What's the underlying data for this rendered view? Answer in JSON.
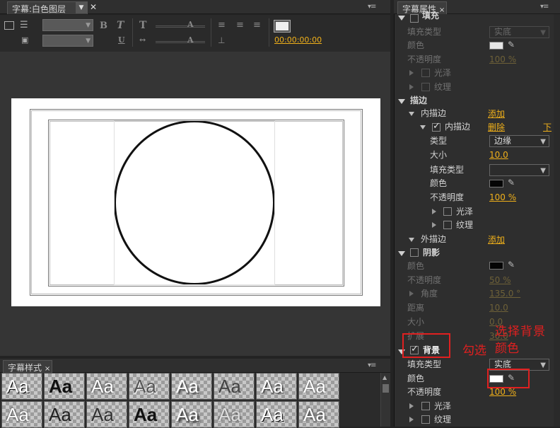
{
  "left_panel": {
    "tab_label": "字幕:白色图层",
    "timecode": "00:00:00:00"
  },
  "style_panel": {
    "tab_label": "字幕样式",
    "sample_text": "Aa"
  },
  "props": {
    "tab_label": "字幕属性",
    "fill_header": "填充",
    "fill_type_label": "填充类型",
    "fill_type_value": "实底",
    "fill_color_label": "颜色",
    "fill_opacity_label": "不透明度",
    "fill_opacity_value": "100 %",
    "fill_sheen": "光泽",
    "fill_texture": "纹理",
    "stroke_header": "描边",
    "inner_stroke": "内描边",
    "add_link": "添加",
    "inner_stroke_item": "内描边",
    "delete_link": "删除",
    "down_link": "下",
    "type_label": "类型",
    "type_value": "边缘",
    "size_label": "大小",
    "size_value": "10.0",
    "fill_type2_label": "填充类型",
    "color_label": "颜色",
    "opacity_label": "不透明度",
    "opacity_value": "100 %",
    "sheen": "光泽",
    "texture": "纹理",
    "outer_stroke": "外描边",
    "add_link2": "添加",
    "shadow_header": "阴影",
    "shadow_color": "颜色",
    "shadow_opacity": "不透明度",
    "shadow_opacity_value": "50 %",
    "shadow_angle": "角度",
    "shadow_angle_value": "135.0 °",
    "shadow_distance": "距离",
    "shadow_distance_value": "10.0",
    "shadow_size": "大小",
    "shadow_size_value": "0.0",
    "shadow_spread": "扩展",
    "shadow_spread_value": "30.0",
    "bg_header": "背景",
    "bg_fill_type": "填充类型",
    "bg_fill_type_value": "实底",
    "bg_color": "颜色",
    "bg_opacity": "不透明度",
    "bg_opacity_value": "100 %",
    "bg_sheen": "光泽",
    "bg_texture": "纹理"
  },
  "annotations": {
    "check_note": "勾选",
    "choose_note_line1": "选择背景",
    "choose_note_line2": "颜色"
  },
  "colors": {
    "accent": "#f0b01a",
    "annotation": "#e02020",
    "canvas": "#ffffff"
  }
}
